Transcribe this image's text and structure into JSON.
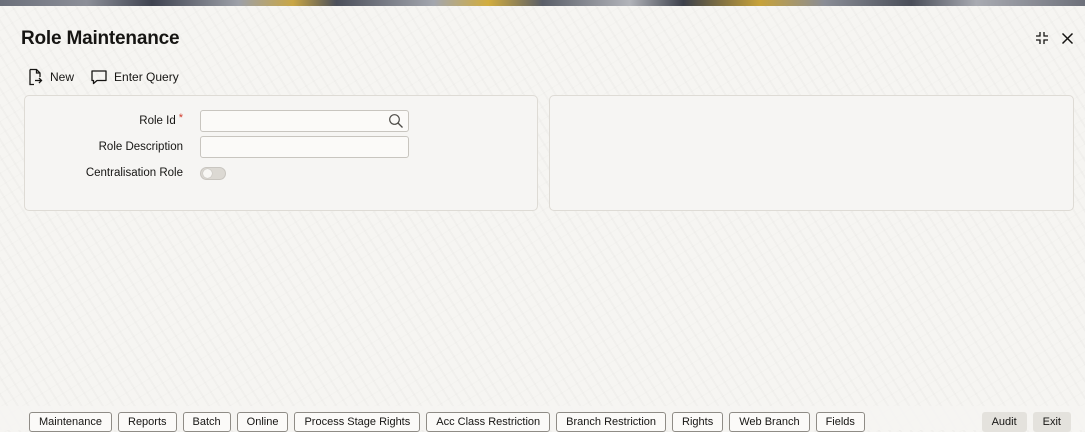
{
  "header": {
    "title": "Role Maintenance"
  },
  "window_controls": {
    "icons": [
      "collapse-icon",
      "close-icon"
    ]
  },
  "toolbar": {
    "new_label": "New",
    "enter_query_label": "Enter Query"
  },
  "form": {
    "role_id": {
      "label": "Role Id",
      "required_marker": "*",
      "value": ""
    },
    "role_description": {
      "label": "Role Description",
      "value": ""
    },
    "centralisation_role": {
      "label": "Centralisation Role",
      "checked": false
    }
  },
  "tabs": [
    {
      "label": "Maintenance"
    },
    {
      "label": "Reports"
    },
    {
      "label": "Batch"
    },
    {
      "label": "Online"
    },
    {
      "label": "Process Stage Rights"
    },
    {
      "label": "Acc Class Restriction"
    },
    {
      "label": "Branch Restriction"
    },
    {
      "label": "Rights"
    },
    {
      "label": "Web Branch"
    },
    {
      "label": "Fields"
    }
  ],
  "actions": {
    "audit_label": "Audit",
    "exit_label": "Exit"
  },
  "colors": {
    "required": "#d03a2a",
    "background": "#f6f5f2",
    "border": "#dedbd5"
  }
}
